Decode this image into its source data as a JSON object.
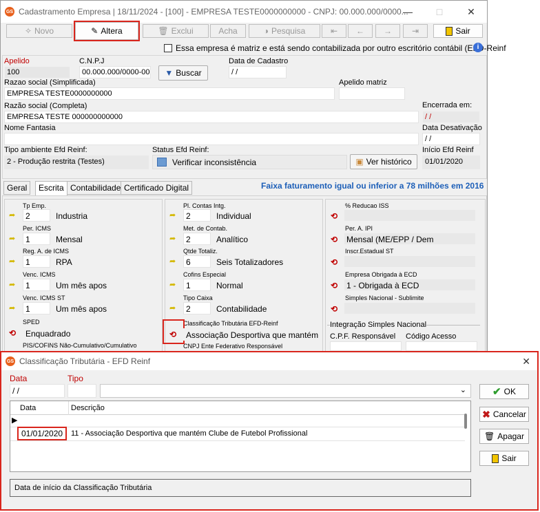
{
  "window": {
    "title": "Cadastramento Empresa | 18/11/2024 - [100] - EMPRESA TESTE0000000000 - CNPJ: 00.000.000/0000...",
    "app_icon": "GS"
  },
  "toolbar": {
    "novo": "Novo",
    "altera": "Altera",
    "exclui": "Exclui",
    "acha": "Acha",
    "pesquisa": "Pesquisa",
    "sair": "Sair"
  },
  "matriz_checkbox": "Essa empresa é matriz e está sendo contabilizada por outro escritório contábil (EFD-Reinf",
  "form": {
    "apelido_label": "Apelido",
    "apelido": "100",
    "cnpj_label": "C.N.P.J",
    "cnpj": "00.000.000/0000-00",
    "buscar": "Buscar",
    "data_cadastro_label": "Data de Cadastro",
    "data_cadastro": " / /",
    "razao_simpl_label": "Razao social (Simplificada)",
    "razao_simpl": "EMPRESA TESTE0000000000",
    "apelido_matriz_label": "Apelido matriz",
    "apelido_matriz": "",
    "razao_comp_label": "Razão social (Completa)",
    "razao_comp": "EMPRESA TESTE 000000000000",
    "encerrada_label": "Encerrada em:",
    "encerrada": " / /",
    "fantasia_label": "Nome Fantasia",
    "fantasia": "",
    "data_desat_label": "Data Desativação",
    "data_desat": " / /",
    "tipo_amb_label": "Tipo ambiente Efd Reinf:",
    "tipo_amb": "2 - Produção restrita (Testes)",
    "status_label": "Status Efd Reinf:",
    "status_btn": "Verificar inconsistência",
    "historico_btn": "Ver histórico",
    "inicio_label": "Início Efd Reinf",
    "inicio": "01/01/2020"
  },
  "tabs": [
    "Geral",
    "Escrita",
    "Contabilidade",
    "Certificado Digital"
  ],
  "faixa_text": "Faixa faturamento igual ou inferior a 78 milhões em 2016",
  "col1": [
    {
      "label": "Tp Emp.",
      "code": "2",
      "desc": "Industria"
    },
    {
      "label": "Per. ICMS",
      "code": "1",
      "desc": "Mensal"
    },
    {
      "label": "Reg. A. de ICMS",
      "code": "1",
      "desc": "RPA"
    },
    {
      "label": "Venc. ICMS",
      "code": "1",
      "desc": "Um mês apos"
    },
    {
      "label": "Venc. ICMS ST",
      "code": "1",
      "desc": "Um mês apos"
    },
    {
      "label": "SPED",
      "desc": "Enquadrado"
    },
    {
      "label": "PIS/COFINS Não-Cumulativo/Cumulativo"
    }
  ],
  "col2": [
    {
      "label": "Pl. Contas Intg.",
      "code": "2",
      "desc": "Individual"
    },
    {
      "label": "Met. de Contab.",
      "code": "2",
      "desc": "Analítico"
    },
    {
      "label": "Qtde Totaliz.",
      "code": "6",
      "desc": "Seis Totalizadores"
    },
    {
      "label": "Cofins Especial",
      "code": "1",
      "desc": "Normal"
    },
    {
      "label": "Tipo Caixa",
      "code": "2",
      "desc": "Contabilidade"
    },
    {
      "label": "Classificação Tributária EFD-Reinf",
      "desc": "Associação Desportiva que mantém Clube"
    },
    {
      "label": "CNPJ Ente Federativo Responsável"
    }
  ],
  "col3": [
    {
      "label": "% Reducao ISS",
      "desc": ""
    },
    {
      "label": "Per. A. IPI",
      "desc": "Mensal (ME/EPP / Dem"
    },
    {
      "label": "Inscr.Estadual ST",
      "desc": ""
    },
    {
      "label": "Empresa Obrigada à ECD",
      "desc": "1 - Obrigada à ECD"
    },
    {
      "label": "Simples Nacional - Sublimite",
      "desc": ""
    }
  ],
  "integracao": {
    "title": "Integração Simples Nacional",
    "cpf_label": "C.P.F. Responsável",
    "acesso_label": "Código Acesso"
  },
  "dialog": {
    "title": "Classificação Tributária - EFD Reinf",
    "data_label": "Data",
    "data_value": " / /",
    "tipo_label": "Tipo",
    "tipo_value": "",
    "columns": [
      "Data",
      "Descrição"
    ],
    "rows": [
      {
        "data": "01/01/2020",
        "desc": "11 - Associação Desportiva que mantém Clube de Futebol Profissional"
      }
    ],
    "hint": "Data de início da Classificação Tributária",
    "ok": "OK",
    "cancelar": "Cancelar",
    "apagar": "Apagar",
    "sair": "Sair"
  }
}
